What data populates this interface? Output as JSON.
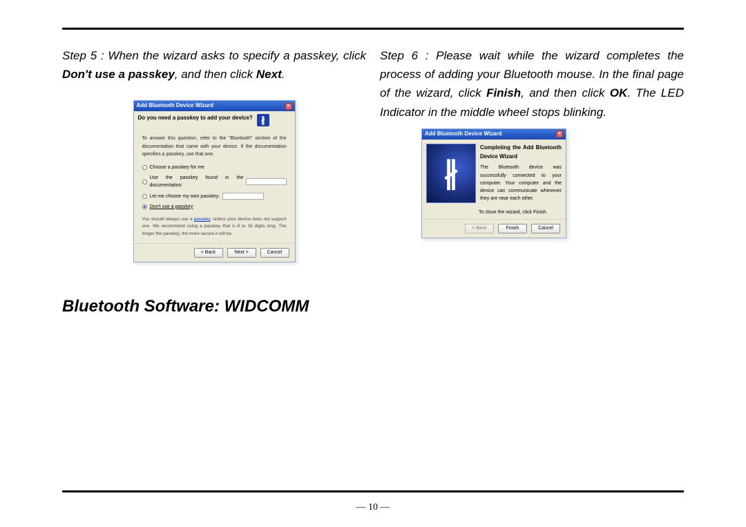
{
  "page_number": "— 10 —",
  "step5": {
    "prefix": "Step 5 : When the wizard asks to specify a passkey, click ",
    "bold1": "Don't use a passkey",
    "mid": ", and then click ",
    "bold2": "Next",
    "suffix": "."
  },
  "step6": {
    "prefix": "Step 6 : Please wait while the wizard completes the process of adding your Bluetooth mouse. In the final page of the wizard, click ",
    "bold1": "Finish",
    "mid": ", and then click ",
    "bold2": "OK",
    "suffix": ". The LED Indicator in the middle wheel stops blinking."
  },
  "dialog1": {
    "title": "Add Bluetooth Device Wizard",
    "heading": "Do you need a passkey to add your device?",
    "desc": "To answer this question, refer to the \"Bluetooth\" section of the documentation that came with your device. If the documentation specifies a passkey, use that one.",
    "opt1": "Choose a passkey for me",
    "opt2": "Use the passkey found in the documentation:",
    "opt3": "Let me choose my own passkey:",
    "opt4": "Don't use a passkey",
    "note_pre": "You should always use a ",
    "note_link": "passkey",
    "note_post": ", unless your device does not support one. We recommend using a passkey that is 8 to 16 digits long. The longer the passkey, the more secure it will be.",
    "btn_back": "< Back",
    "btn_next": "Next >",
    "btn_cancel": "Cancel"
  },
  "dialog2": {
    "title": "Add Bluetooth Device Wizard",
    "heading": "Completing the Add Bluetooth Device Wizard",
    "body": "The Bluetooth device was successfully connected to your computer. Your computer and the device can communicate whenever they are near each other.",
    "foot": "To close the wizard, click Finish.",
    "btn_back": "< Back",
    "btn_finish": "Finish",
    "btn_cancel": "Cancel"
  },
  "section_heading": "Bluetooth Software: WIDCOMM"
}
